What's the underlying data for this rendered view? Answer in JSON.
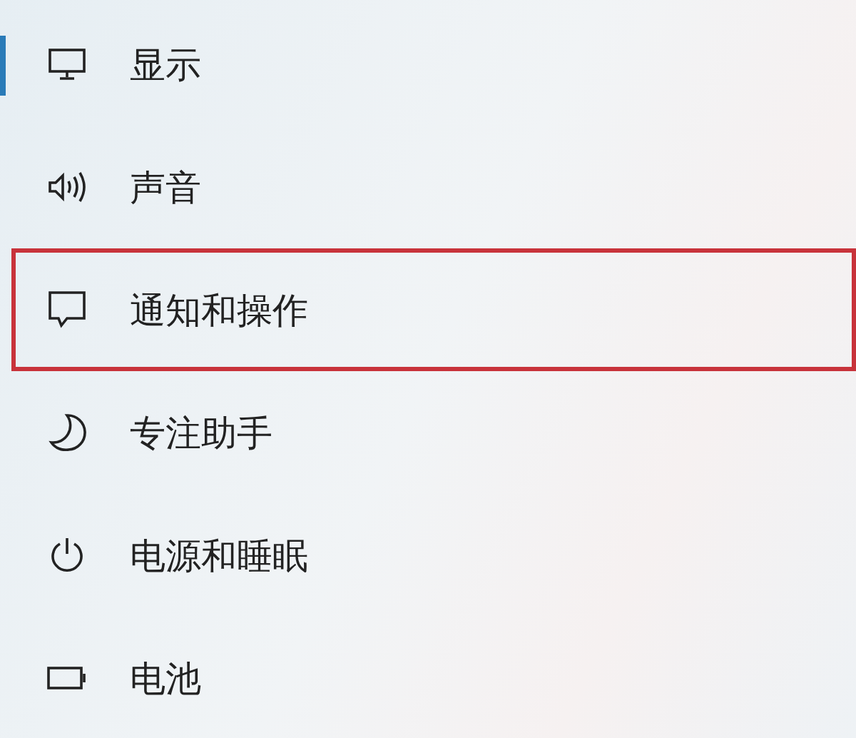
{
  "sidebar": {
    "items": [
      {
        "label": "显示",
        "selected": true,
        "highlighted": false
      },
      {
        "label": "声音",
        "selected": false,
        "highlighted": false
      },
      {
        "label": "通知和操作",
        "selected": false,
        "highlighted": true
      },
      {
        "label": "专注助手",
        "selected": false,
        "highlighted": false
      },
      {
        "label": "电源和睡眠",
        "selected": false,
        "highlighted": false
      },
      {
        "label": "电池",
        "selected": false,
        "highlighted": false
      }
    ]
  }
}
